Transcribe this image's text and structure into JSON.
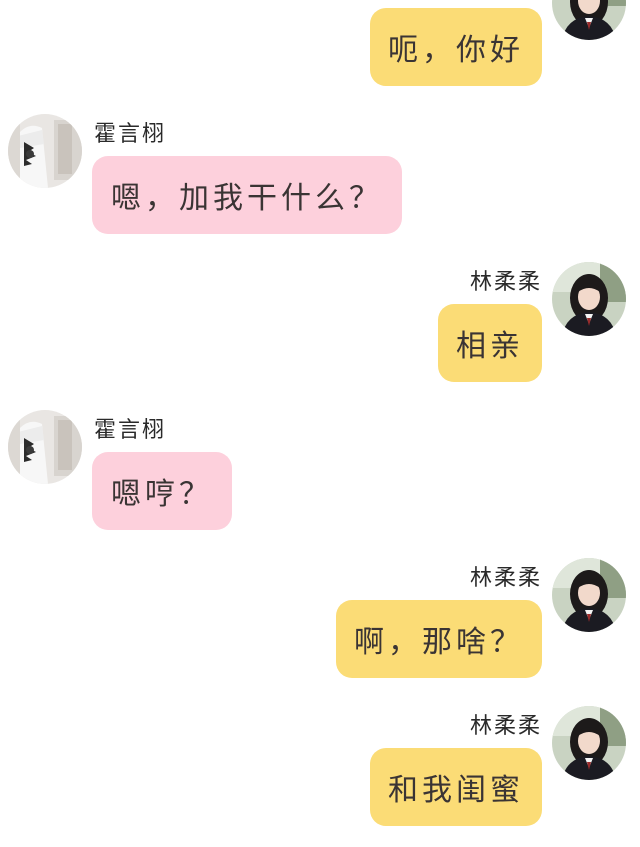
{
  "colors": {
    "my_bubble": "#fbdc76",
    "their_bubble": "#fdd0dc",
    "text": "#3a3434",
    "background": "#ffffff"
  },
  "contacts": {
    "me": {
      "name": "林柔柔",
      "avatar_icon": "girl-dark-hair-avatar-icon"
    },
    "other": {
      "name": "霍言栩",
      "avatar_icon": "boy-white-shirt-avatar-icon"
    }
  },
  "messages": [
    {
      "from": "me",
      "text": "呃，你好",
      "show_name": false
    },
    {
      "from": "other",
      "text": "嗯，加我干什么？",
      "show_name": true
    },
    {
      "from": "me",
      "text": "相亲",
      "show_name": true
    },
    {
      "from": "other",
      "text": "嗯哼？",
      "show_name": true
    },
    {
      "from": "me",
      "text": "啊，那啥？",
      "show_name": true
    },
    {
      "from": "me",
      "text": "和我闺蜜",
      "show_name": true
    }
  ]
}
